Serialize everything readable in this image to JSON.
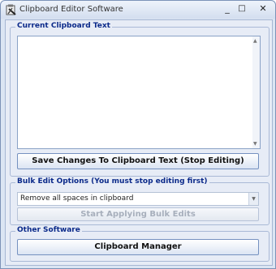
{
  "window": {
    "title": "Clipboard Editor Software",
    "minimize": "_",
    "maximize": "□",
    "close": "✕"
  },
  "current_text": {
    "group_label": "Current Clipboard Text",
    "text_value": "",
    "save_button_label": "Save Changes To Clipboard Text (Stop Editing)"
  },
  "bulk_edit": {
    "group_label": "Bulk Edit Options (You must stop editing first)",
    "selected_option": "Remove all spaces in clipboard",
    "apply_button_label": "Start Applying Bulk Edits"
  },
  "other_software": {
    "group_label": "Other Software",
    "manager_button_label": "Clipboard Manager"
  }
}
